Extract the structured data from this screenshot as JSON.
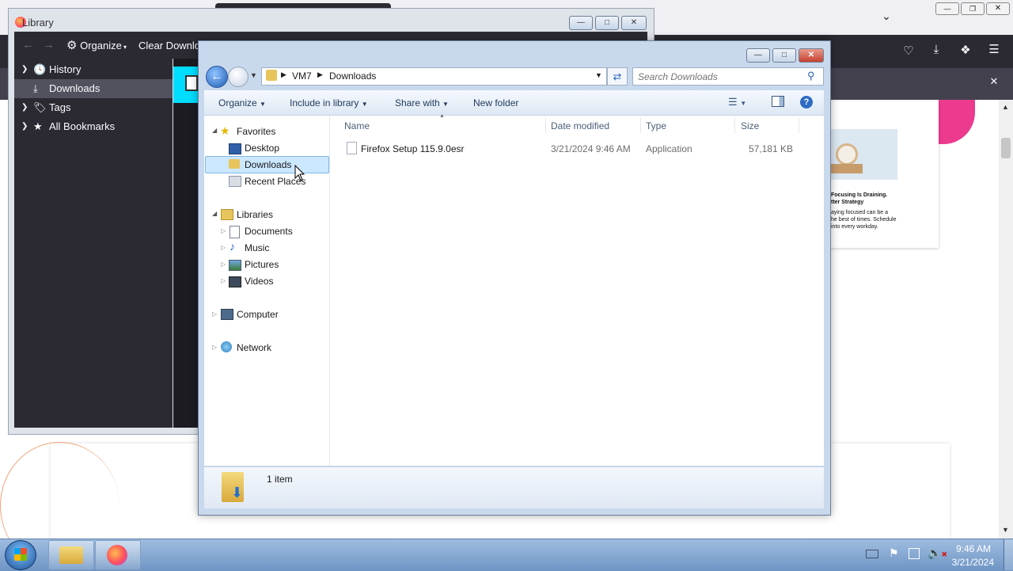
{
  "firefox_bg": {
    "card_lines": [
      "Focusing Is Draining.",
      "tter Strategy",
      "aying focused can be a",
      "he best of times. Schedule",
      "into every workday."
    ]
  },
  "library": {
    "title": "Library",
    "toolbar": {
      "organize": "Organize",
      "clear": "Clear Downloa"
    },
    "items": [
      {
        "label": "History",
        "selected": false
      },
      {
        "label": "Downloads",
        "selected": true
      },
      {
        "label": "Tags",
        "selected": false
      },
      {
        "label": "All Bookmarks",
        "selected": false
      }
    ]
  },
  "explorer": {
    "breadcrumb": [
      "VM7",
      "Downloads"
    ],
    "search_placeholder": "Search Downloads",
    "commands": {
      "organize": "Organize",
      "include": "Include in library",
      "share": "Share with",
      "new_folder": "New folder"
    },
    "nav": {
      "favorites": "Favorites",
      "desktop": "Desktop",
      "downloads": "Downloads",
      "recent": "Recent Places",
      "libraries": "Libraries",
      "documents": "Documents",
      "music": "Music",
      "pictures": "Pictures",
      "videos": "Videos",
      "computer": "Computer",
      "network": "Network"
    },
    "columns": {
      "name": "Name",
      "date": "Date modified",
      "type": "Type",
      "size": "Size"
    },
    "files": [
      {
        "name": "Firefox Setup 115.9.0esr",
        "date": "3/21/2024 9:46 AM",
        "type": "Application",
        "size": "57,181 KB"
      }
    ],
    "status": "1 item"
  },
  "taskbar": {
    "time": "9:46 AM",
    "date": "3/21/2024"
  },
  "colors": {
    "firefox_dark": "#2b2a33",
    "explorer_frame": "#c8d9ee",
    "selection": "#cce8ff",
    "close_red": "#c7402f"
  }
}
